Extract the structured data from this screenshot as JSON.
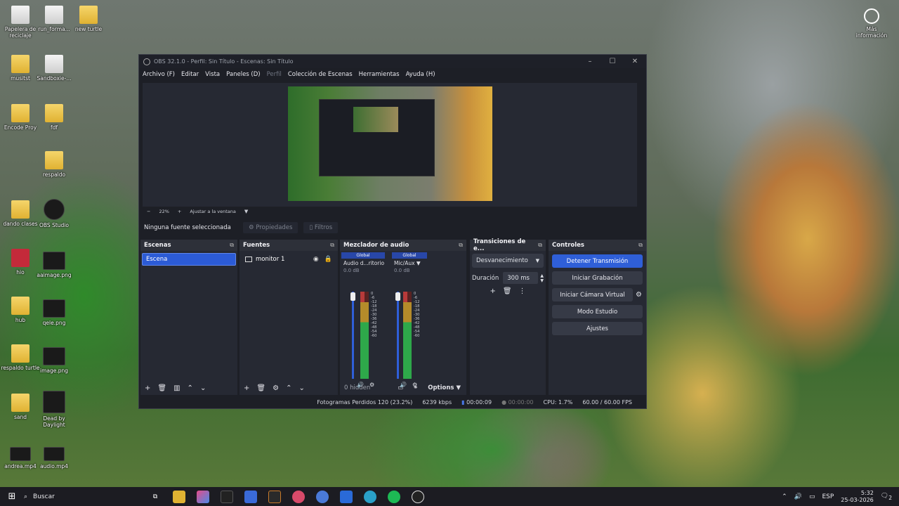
{
  "desktop": {
    "icons": [
      {
        "label": "Papelera de reciclaje",
        "type": "file"
      },
      {
        "label": "run_forma...",
        "type": "file"
      },
      {
        "label": "new turtle",
        "type": "folder"
      },
      {
        "label": "musitst",
        "type": "folder"
      },
      {
        "label": "Sandboxie-...",
        "type": "file"
      },
      {
        "label": "Encode Proy",
        "type": "folder"
      },
      {
        "label": "fdf",
        "type": "folder"
      },
      {
        "label": "respaldo",
        "type": "folder"
      },
      {
        "label": "dando clases",
        "type": "folder"
      },
      {
        "label": "OBS Studio",
        "type": "dark"
      },
      {
        "label": "hio",
        "type": "red"
      },
      {
        "label": "aaimage.png",
        "type": "dark"
      },
      {
        "label": "hub",
        "type": "folder"
      },
      {
        "label": "qele.png",
        "type": "dark"
      },
      {
        "label": "respaldo turtle",
        "type": "folder"
      },
      {
        "label": "image.png",
        "type": "dark"
      },
      {
        "label": "sand",
        "type": "folder"
      },
      {
        "label": "Dead by Daylight",
        "type": "dark"
      },
      {
        "label": "andrea.mp4",
        "type": "dark"
      },
      {
        "label": "audio.mp4",
        "type": "dark"
      },
      {
        "label": "Más información",
        "type": "dark"
      }
    ]
  },
  "obs": {
    "title": "OBS 32.1.0 - Perfil: Sin Título - Escenas: Sin Título",
    "menu": [
      "Archivo (F)",
      "Editar",
      "Vista",
      "Paneles (D)",
      "Perfil",
      "Colección de Escenas",
      "Herramientas",
      "Ayuda (H)"
    ],
    "zoom": {
      "minus": "−",
      "level": "22%",
      "plus": "+",
      "fit": "Ajustar a la ventana"
    },
    "source_bar": {
      "label": "Ninguna fuente seleccionada",
      "properties": "Propiedades",
      "filters": "Filtros"
    },
    "scenes": {
      "title": "Escenas",
      "items": [
        "Escena"
      ]
    },
    "sources": {
      "title": "Fuentes",
      "items": [
        "monitor 1"
      ]
    },
    "mixer": {
      "title": "Mezclador de audio",
      "channels": [
        {
          "global": "Global",
          "name": "Audio d...ritorio",
          "db": "0.0 dB"
        },
        {
          "global": "Global",
          "name": "Mic/Aux",
          "db": "0.0 dB"
        }
      ],
      "ticks": [
        "0",
        "-6",
        "-12",
        "-18",
        "-24",
        "-30",
        "-36",
        "-42",
        "-48",
        "-54",
        "-60"
      ],
      "hidden": "0 hidden",
      "options": "Options"
    },
    "transitions": {
      "title": "Transiciones de e...",
      "selected": "Desvanecimiento",
      "duration_label": "Duración",
      "duration_value": "300 ms"
    },
    "controls": {
      "title": "Controles",
      "buttons": [
        "Detener Transmisión",
        "Iniciar Grabación",
        "Iniciar Cámara Virtual",
        "Modo Estudio",
        "Ajustes"
      ]
    },
    "status": {
      "dropped": "Fotogramas Perdidos 120 (23.2%)",
      "bitrate": "6239 kbps",
      "stream_time": "00:00:09",
      "rec_time": "00:00:00",
      "cpu": "CPU: 1.7%",
      "fps": "60.00 / 60.00 FPS"
    }
  },
  "taskbar": {
    "search": "Buscar",
    "lang": "ESP",
    "time": "5:32",
    "date": "25-03-2026",
    "notif": "2"
  }
}
